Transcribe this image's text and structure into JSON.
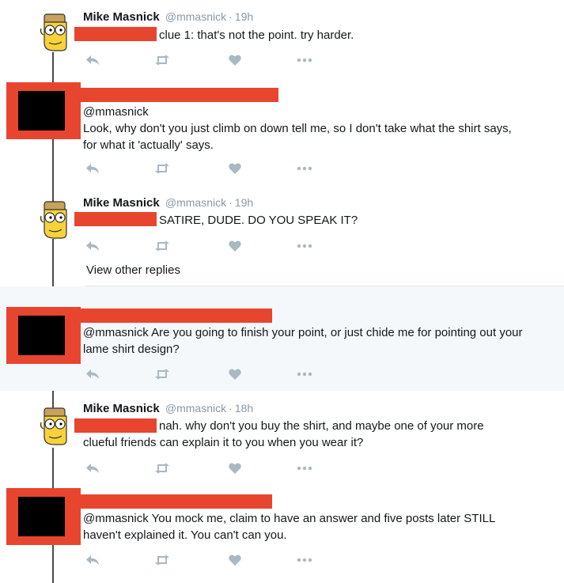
{
  "colors": {
    "redaction": "#e8452f",
    "action_icon": "#aab8c2",
    "meta_text": "#8899a6",
    "thread_line": "#4a4a4a"
  },
  "actions": {
    "reply_icon": "reply-icon",
    "retweet_icon": "retweet-icon",
    "like_icon": "heart-icon",
    "more_icon": "more-icon"
  },
  "tweets": [
    {
      "author": "Mike Masnick",
      "handle": "@mmasnick",
      "separator": "·",
      "time": "19h",
      "text": "clue 1: that's not the point. try harder."
    },
    {
      "mention": "@mmasnick",
      "text": "Look, why don't you just climb on down tell me, so I don't take what the shirt says, for what it 'actually' says."
    },
    {
      "author": "Mike Masnick",
      "handle": "@mmasnick",
      "separator": "·",
      "time": "19h",
      "text": "SATIRE, DUDE. DO YOU SPEAK IT?"
    },
    {
      "text": "@mmasnick Are you going to finish your point, or just chide me for pointing out your lame shirt design?"
    },
    {
      "author": "Mike Masnick",
      "handle": "@mmasnick",
      "separator": "·",
      "time": "18h",
      "text_first": "nah. why don't you buy the shirt, and maybe one of your more",
      "text_rest": "clueful friends can explain it to you when you wear it?"
    },
    {
      "text": "@mmasnick You mock me, claim to have an answer and five posts later STILL haven't explained it. You can't can you."
    }
  ],
  "view_other_replies": "View other replies"
}
